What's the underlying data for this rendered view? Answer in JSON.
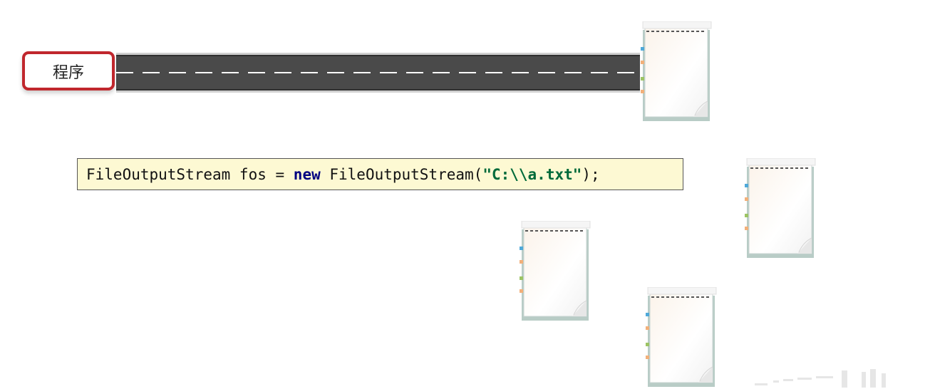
{
  "program_label": "程序",
  "code": {
    "prefix": "FileOutputStream fos = ",
    "keyword": "new",
    "middle": " FileOutputStream(",
    "string": "\"C:\\\\a.txt\"",
    "suffix": ");"
  },
  "colors": {
    "program_border": "#c0272d",
    "road": "#4a4a4a",
    "code_background": "#fdf9d3",
    "keyword": "#000080",
    "string": "#006a3a"
  },
  "icons": {
    "file": "notebook-icon"
  }
}
